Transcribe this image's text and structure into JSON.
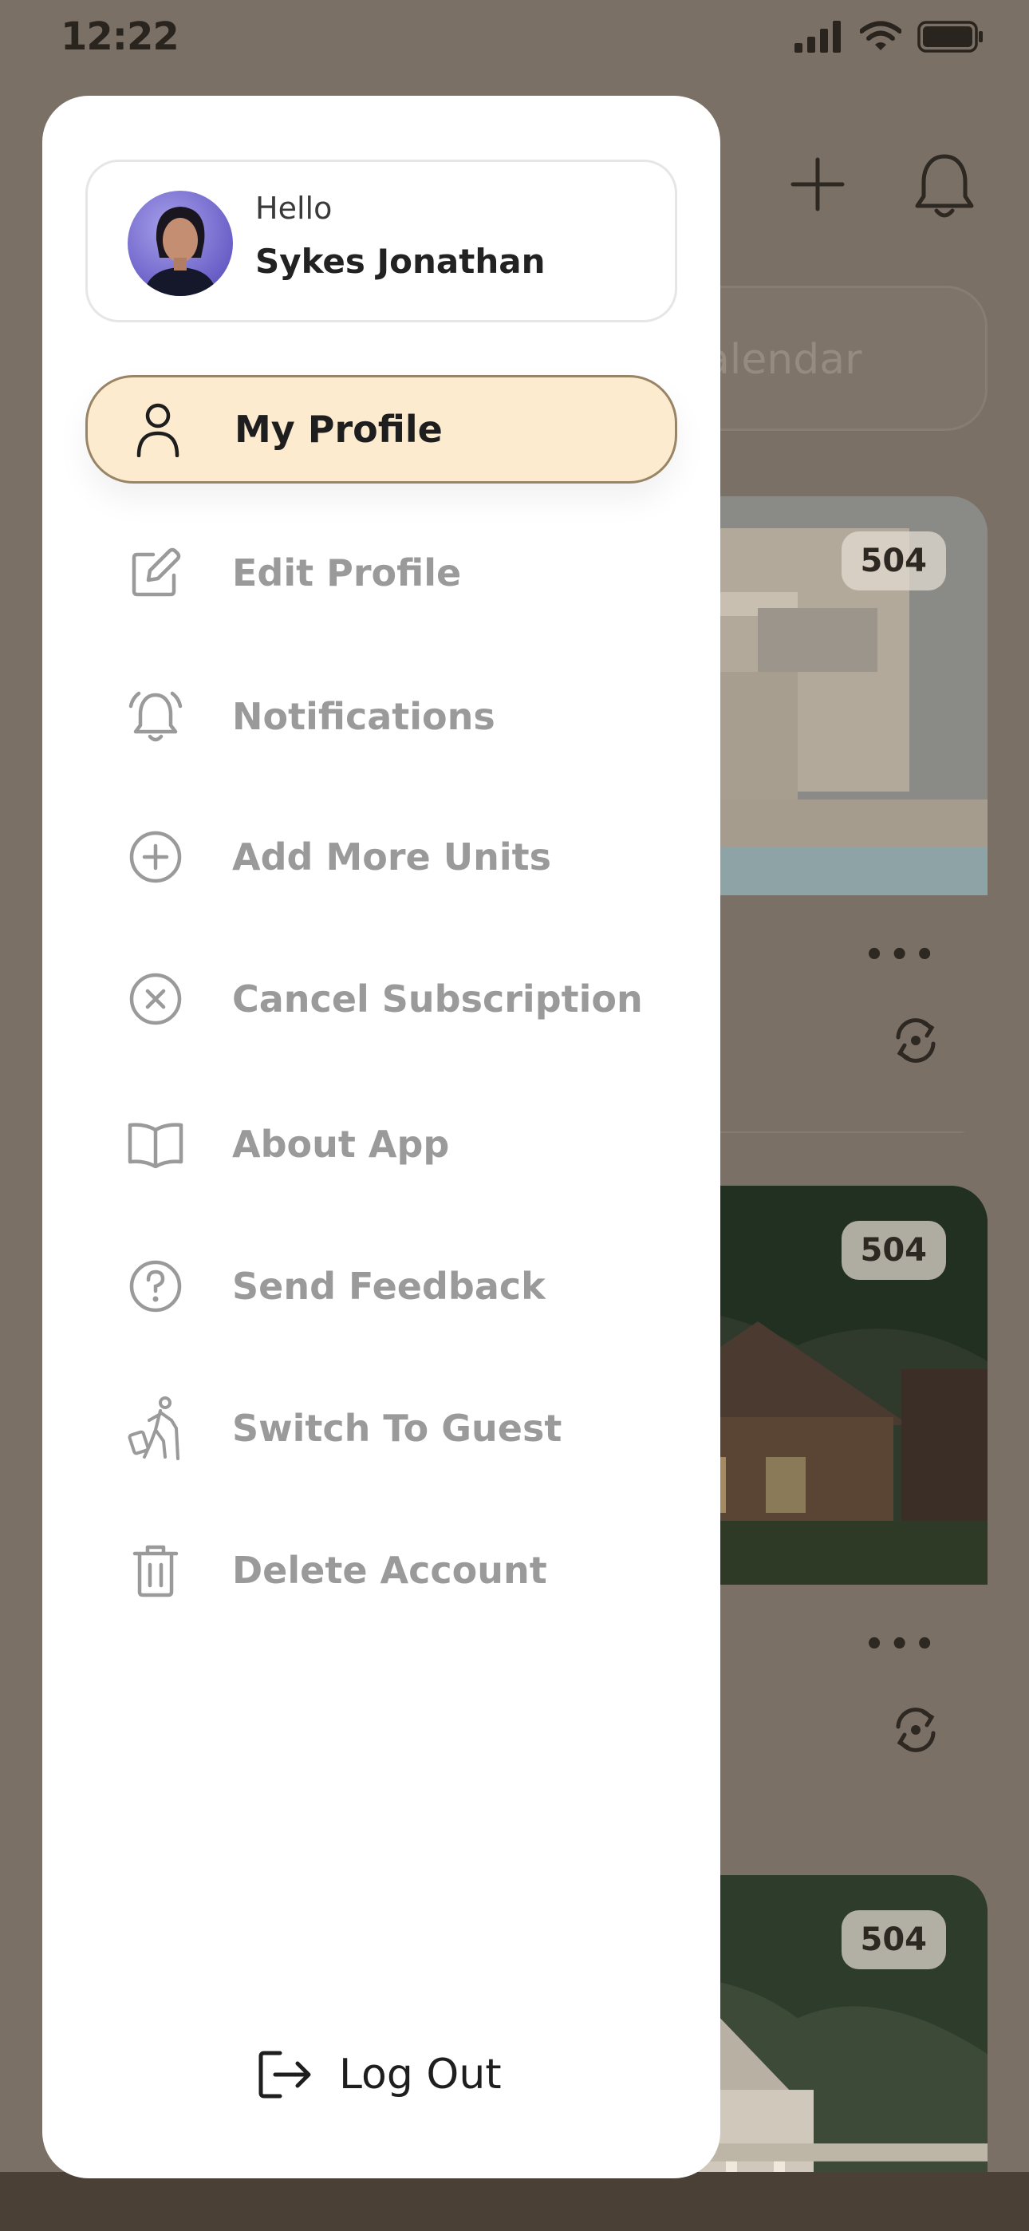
{
  "status_bar": {
    "time": "12:22"
  },
  "background": {
    "search_placeholder_fragment": "alendar",
    "cards": [
      {
        "badge": "504"
      },
      {
        "badge": "504"
      },
      {
        "badge": "504"
      }
    ]
  },
  "drawer": {
    "profile": {
      "greeting": "Hello",
      "name": "Sykes Jonathan"
    },
    "menu": [
      {
        "label": "My Profile",
        "icon": "user-icon",
        "active": true
      },
      {
        "label": "Edit Profile",
        "icon": "edit-icon"
      },
      {
        "label": "Notifications",
        "icon": "bell-icon"
      },
      {
        "label": "Add More Units",
        "icon": "plus-circle-icon"
      },
      {
        "label": "Cancel Subscription",
        "icon": "x-circle-icon"
      },
      {
        "label": "About App",
        "icon": "book-icon"
      },
      {
        "label": "Send Feedback",
        "icon": "help-circle-icon"
      },
      {
        "label": "Switch To Guest",
        "icon": "traveler-icon"
      },
      {
        "label": "Delete Account",
        "icon": "trash-icon"
      }
    ],
    "logout_label": "Log Out"
  },
  "colors": {
    "active_bg": "#fdebd0",
    "active_border": "#9a8466",
    "inactive_text": "#9a9a9a",
    "overlay": "#7a7066"
  }
}
